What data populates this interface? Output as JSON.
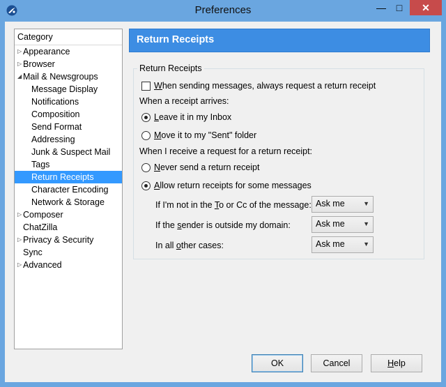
{
  "window": {
    "title": "Preferences"
  },
  "titlebar_buttons": {
    "minimize": "—",
    "maximize": "□",
    "close": "✕"
  },
  "category": {
    "header": "Category",
    "items": [
      {
        "label": "Appearance",
        "level": 0,
        "arrow": "▷"
      },
      {
        "label": "Browser",
        "level": 0,
        "arrow": "▷"
      },
      {
        "label": "Mail & Newsgroups",
        "level": 0,
        "arrow": "◢"
      },
      {
        "label": "Message Display",
        "level": 1
      },
      {
        "label": "Notifications",
        "level": 1
      },
      {
        "label": "Composition",
        "level": 1
      },
      {
        "label": "Send Format",
        "level": 1
      },
      {
        "label": "Addressing",
        "level": 1
      },
      {
        "label": "Junk & Suspect Mail",
        "level": 1
      },
      {
        "label": "Tags",
        "level": 1
      },
      {
        "label": "Return Receipts",
        "level": 1,
        "selected": true
      },
      {
        "label": "Character Encoding",
        "level": 1
      },
      {
        "label": "Network & Storage",
        "level": 1
      },
      {
        "label": "Composer",
        "level": 0,
        "arrow": "▷"
      },
      {
        "label": "ChatZilla",
        "level": 0
      },
      {
        "label": "Privacy & Security",
        "level": 0,
        "arrow": "▷"
      },
      {
        "label": "Sync",
        "level": 0
      },
      {
        "label": "Advanced",
        "level": 0,
        "arrow": "▷"
      }
    ]
  },
  "panel": {
    "title": "Return Receipts",
    "group_label": "Return Receipts",
    "always_request": {
      "pre": "",
      "key": "W",
      "post": "hen sending messages, always request a return receipt",
      "checked": false
    },
    "arrives_label": "When a receipt arrives:",
    "leave_inbox": {
      "pre": "",
      "key": "L",
      "post": "eave it in my Inbox",
      "selected": true
    },
    "move_sent": {
      "pre": "",
      "key": "M",
      "post": "ove it to my \"Sent\" folder",
      "selected": false
    },
    "request_label": "When I receive a request for a return receipt:",
    "never_send": {
      "pre": "",
      "key": "N",
      "post": "ever send a return receipt",
      "selected": false
    },
    "allow_some": {
      "pre": "",
      "key": "A",
      "post": "llow return receipts for some messages",
      "selected": true
    },
    "rules": [
      {
        "pre": "If I'm not in the ",
        "key": "T",
        "post": "o or Cc of the message:",
        "value": "Ask me"
      },
      {
        "pre": "If the ",
        "key": "s",
        "post": "ender is outside my domain:",
        "value": "Ask me"
      },
      {
        "pre": "In all ",
        "key": "o",
        "post": "ther cases:",
        "value": "Ask me"
      }
    ]
  },
  "buttons": {
    "ok": "OK",
    "cancel": "Cancel",
    "help": {
      "pre": "",
      "key": "H",
      "post": "elp"
    }
  }
}
